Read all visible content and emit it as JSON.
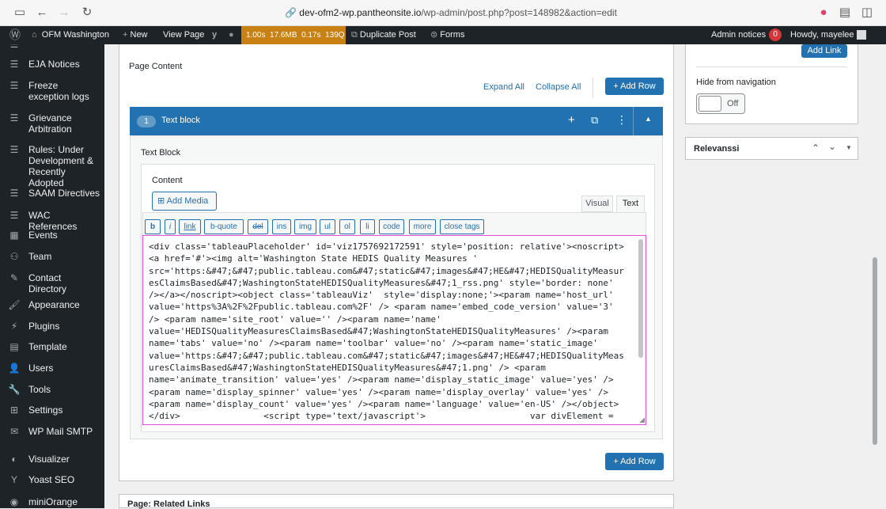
{
  "browser": {
    "url_host": "dev-ofm2-wp.pantheonsite.io",
    "url_path": "/wp-admin/post.php?post=148982&action=edit"
  },
  "adminbar": {
    "site_name": "OFM Washington",
    "new_label": "New",
    "view_page": "View Page",
    "qm": {
      "time": "1.00s",
      "memory": "17.6MB",
      "db_time": "0.17s",
      "queries": "139Q"
    },
    "duplicate_post": "Duplicate Post",
    "forms": "Forms",
    "admin_notices": "Admin notices",
    "notices_count": "0",
    "howdy": "Howdy, mayelee"
  },
  "sidebar": {
    "items": [
      {
        "label": "EJA Notices",
        "icon": "database-icon"
      },
      {
        "label": "Freeze exception logs",
        "icon": "database-icon"
      },
      {
        "label": "Grievance Arbitration",
        "icon": "database-icon"
      },
      {
        "label": "Rules: Under Development & Recently Adopted",
        "icon": "database-icon"
      },
      {
        "label": "SAAM Directives",
        "icon": "database-icon"
      },
      {
        "label": "WAC References",
        "icon": "database-icon"
      },
      {
        "label": "Events",
        "icon": "calendar-icon"
      },
      {
        "label": "Team",
        "icon": "groups-icon"
      },
      {
        "label": "Contact Directory",
        "icon": "edit-icon"
      },
      {
        "label": "Appearance",
        "icon": "brush-icon"
      },
      {
        "label": "Plugins",
        "icon": "plugin-icon"
      },
      {
        "label": "Template",
        "icon": "grid-icon"
      },
      {
        "label": "Users",
        "icon": "user-icon"
      },
      {
        "label": "Tools",
        "icon": "wrench-icon"
      },
      {
        "label": "Settings",
        "icon": "settings-icon"
      },
      {
        "label": "WP Mail SMTP",
        "icon": "mail-icon"
      },
      {
        "label": "Visualizer",
        "icon": "chart-icon"
      },
      {
        "label": "Yoast SEO",
        "icon": "yoast-icon"
      },
      {
        "label": "miniOrange",
        "icon": "miniorange-icon"
      }
    ]
  },
  "editor": {
    "page_content_label": "Page Content",
    "expand_all": "Expand All",
    "collapse_all": "Collapse All",
    "add_row": "+ Add Row",
    "block_number": "1",
    "block_title": "Text block",
    "block_type_label": "Text Block",
    "content_label": "Content",
    "add_media": "Add Media",
    "tab_visual": "Visual",
    "tab_text": "Text",
    "quicktags": [
      "b",
      "i",
      "link",
      "b-quote",
      "del",
      "ins",
      "img",
      "ul",
      "ol",
      "li",
      "code",
      "more",
      "close tags"
    ],
    "code_text": "<div class='tableauPlaceholder' id='viz1757692172591' style='position: relative'><noscript>\n<a href='#'><img alt='Washington State HEDIS Quality Measures '\nsrc='https:&#47;&#47;public.tableau.com&#47;static&#47;images&#47;HE&#47;HEDISQualityMeasur\nesClaimsBased&#47;WashingtonStateHEDISQualityMeasures&#47;1_rss.png' style='border: none'\n/></a></noscript><object class='tableauViz'  style='display:none;'><param name='host_url'\nvalue='https%3A%2F%2Fpublic.tableau.com%2F' /> <param name='embed_code_version' value='3'\n/> <param name='site_root' value='' /><param name='name'\nvalue='HEDISQualityMeasuresClaimsBased&#47;WashingtonStateHEDISQualityMeasures' /><param\nname='tabs' value='no' /><param name='toolbar' value='no' /><param name='static_image'\nvalue='https:&#47;&#47;public.tableau.com&#47;static&#47;images&#47;HE&#47;HEDISQualityMeas\nuresClaimsBased&#47;WashingtonStateHEDISQualityMeasures&#47;1.png' /> <param\nname='animate_transition' value='yes' /><param name='display_static_image' value='yes' />\n<param name='display_spinner' value='yes' /><param name='display_overlay' value='yes' />\n<param name='display_count' value='yes' /><param name='language' value='en-US' /></object>\n</div>                <script type='text/javascript'>                    var divElement =",
    "bottom_add_row": "+ Add Row",
    "related_links": "Page: Related Links"
  },
  "right": {
    "add_link": "Add Link",
    "hide_nav_label": "Hide from navigation",
    "toggle_value": "Off",
    "relevanssi": "Relevanssi"
  },
  "colors": {
    "accent": "#2271b1",
    "adminbar": "#1d2327",
    "highlight": "#e64cdb",
    "qm": "#c98113"
  }
}
